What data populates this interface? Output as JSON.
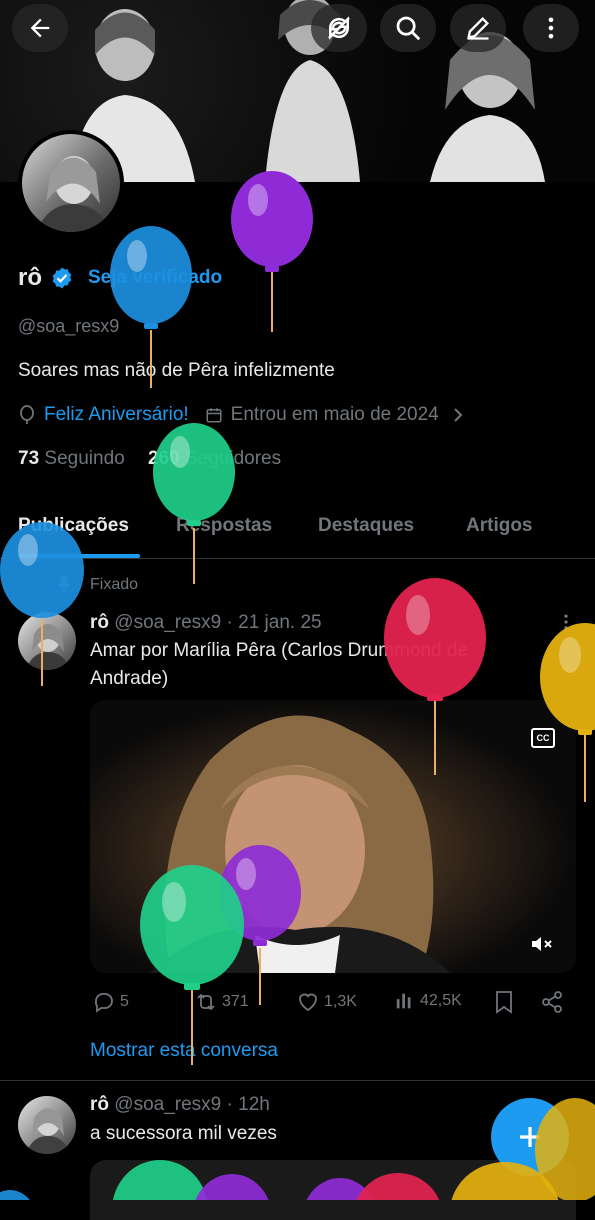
{
  "header": {
    "back_icon": "arrow-left-icon",
    "icons": [
      "no-sync-icon",
      "search-icon",
      "compose-icon",
      "more-vertical-icon"
    ]
  },
  "profile": {
    "name": "rô",
    "verify_cta": "Seja verificado",
    "handle": "@soa_resx9",
    "bio": "Soares mas não de Pêra infelizmente",
    "birthday": "Feliz Aniversário!",
    "joined": "Entrou em maio de 2024",
    "following_count": "73",
    "following_label": "Seguindo",
    "followers_count": "260",
    "followers_label": "Seguidores"
  },
  "tabs": [
    "Publicações",
    "Respostas",
    "Destaques",
    "Artigos"
  ],
  "posts": [
    {
      "pinned_label": "Fixado",
      "name": "rô",
      "handle": "@soa_resx9",
      "time": "· 21 jan. 25",
      "text": "Amar por Marília Pêra (Carlos Drummond de Andrade)",
      "cc_label": "CC",
      "replies": "5",
      "reposts": "371",
      "likes": "1,3K",
      "views": "42,5K",
      "show_thread": "Mostrar esta conversa"
    },
    {
      "name": "rô",
      "handle": "@soa_resx9",
      "time": "· 12h",
      "text": "a sucessora mil vezes"
    }
  ],
  "colors": {
    "accent": "#1d9bf0",
    "background": "#000000",
    "text": "#e7e9ea",
    "muted": "#71767b",
    "balloon_purple": "#8e2bd6",
    "balloon_blue": "#1d8fe0",
    "balloon_green": "#1fcf8a",
    "balloon_red": "#e3234f",
    "balloon_yellow": "#e4b10f"
  }
}
